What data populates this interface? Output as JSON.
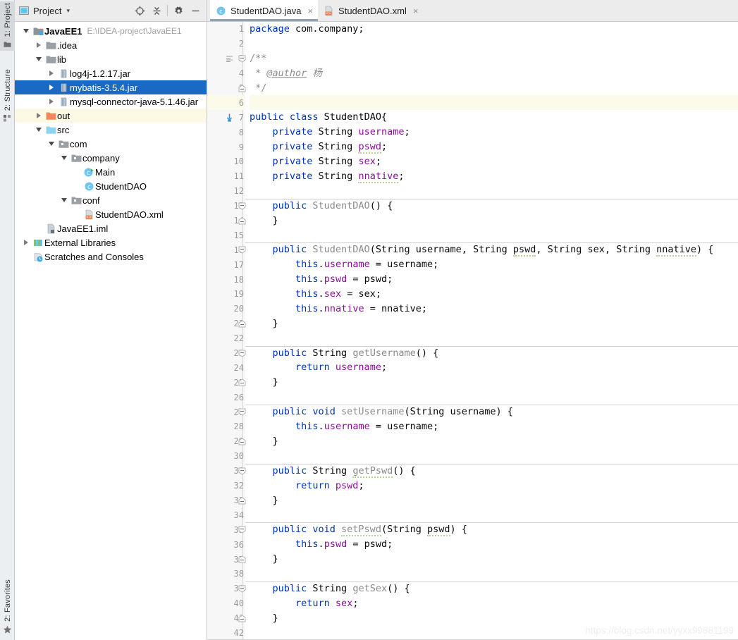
{
  "tool_strip": {
    "tabs": [
      {
        "label": "1: Project",
        "icon": "project-panel-icon",
        "active": true
      },
      {
        "label": "2: Structure",
        "icon": "structure-icon",
        "active": false
      },
      {
        "label": "2: Favorites",
        "icon": "star-icon",
        "active": false
      }
    ]
  },
  "project_panel": {
    "title": "Project",
    "caret": "▾",
    "buttons": [
      {
        "name": "locate-button",
        "icon": "target-icon"
      },
      {
        "name": "collapse-all-button",
        "icon": "collapse-all-icon"
      },
      {
        "name": "settings-button",
        "icon": "gear-icon"
      },
      {
        "name": "hide-button",
        "icon": "minimize-icon"
      }
    ],
    "tree": [
      {
        "label": "JavaEE1",
        "path": "E:\\IDEA-project\\JavaEE1",
        "icon": "module-icon",
        "indent": 0,
        "arrow": "expanded",
        "bold": true,
        "state": "normal"
      },
      {
        "label": ".idea",
        "path": "",
        "icon": "folder-icon",
        "indent": 1,
        "arrow": "collapsed",
        "bold": false,
        "state": "normal"
      },
      {
        "label": "lib",
        "path": "",
        "icon": "folder-icon",
        "indent": 1,
        "arrow": "expanded",
        "bold": false,
        "state": "normal"
      },
      {
        "label": "log4j-1.2.17.jar",
        "path": "",
        "icon": "jar-icon",
        "indent": 2,
        "arrow": "collapsed",
        "bold": false,
        "state": "normal"
      },
      {
        "label": "mybatis-3.5.4.jar",
        "path": "",
        "icon": "jar-icon",
        "indent": 2,
        "arrow": "collapsed",
        "bold": false,
        "state": "selected"
      },
      {
        "label": "mysql-connector-java-5.1.46.jar",
        "path": "",
        "icon": "jar-icon",
        "indent": 2,
        "arrow": "collapsed",
        "bold": false,
        "state": "normal"
      },
      {
        "label": "out",
        "path": "",
        "icon": "folder-excluded-icon",
        "indent": 1,
        "arrow": "collapsed",
        "bold": false,
        "state": "excluded"
      },
      {
        "label": "src",
        "path": "",
        "icon": "source-folder-icon",
        "indent": 1,
        "arrow": "expanded",
        "bold": false,
        "state": "normal"
      },
      {
        "label": "com",
        "path": "",
        "icon": "package-icon",
        "indent": 2,
        "arrow": "expanded",
        "bold": false,
        "state": "normal"
      },
      {
        "label": "company",
        "path": "",
        "icon": "package-icon",
        "indent": 3,
        "arrow": "expanded",
        "bold": false,
        "state": "normal"
      },
      {
        "label": "Main",
        "path": "",
        "icon": "java-class-runnable-icon",
        "indent": 4,
        "arrow": "none",
        "bold": false,
        "state": "normal"
      },
      {
        "label": "StudentDAO",
        "path": "",
        "icon": "java-class-icon",
        "indent": 4,
        "arrow": "none",
        "bold": false,
        "state": "normal"
      },
      {
        "label": "conf",
        "path": "",
        "icon": "package-icon",
        "indent": 3,
        "arrow": "expanded",
        "bold": false,
        "state": "normal"
      },
      {
        "label": "StudentDAO.xml",
        "path": "",
        "icon": "xml-file-icon",
        "indent": 4,
        "arrow": "none",
        "bold": false,
        "state": "normal"
      },
      {
        "label": "JavaEE1.iml",
        "path": "",
        "icon": "iml-file-icon",
        "indent": 1,
        "arrow": "none",
        "bold": false,
        "state": "normal"
      },
      {
        "label": "External Libraries",
        "path": "",
        "icon": "libraries-icon",
        "indent": 0,
        "arrow": "collapsed",
        "bold": false,
        "state": "normal"
      },
      {
        "label": "Scratches and Consoles",
        "path": "",
        "icon": "scratches-icon",
        "indent": 0,
        "arrow": "none",
        "bold": false,
        "state": "normal"
      }
    ]
  },
  "editor": {
    "tabs": [
      {
        "label": "StudentDAO.java",
        "icon": "java-class-icon",
        "close": "×",
        "active": true
      },
      {
        "label": "StudentDAO.xml",
        "icon": "xml-file-icon",
        "close": "×",
        "active": false
      }
    ],
    "watermark": "https://blog.csdn.net/yyxx99881199",
    "lines": [
      {
        "n": "1",
        "fold": "none",
        "gicon": "",
        "caret": false,
        "sep": false,
        "tokens": [
          {
            "t": "package ",
            "c": "kw"
          },
          {
            "t": "com.company;",
            "c": "plain"
          }
        ]
      },
      {
        "n": "2",
        "fold": "none",
        "gicon": "",
        "caret": false,
        "sep": false,
        "tokens": []
      },
      {
        "n": "3",
        "fold": "start",
        "gicon": "javadoc-icon",
        "caret": false,
        "sep": false,
        "tokens": [
          {
            "t": "/**",
            "c": "cmt"
          }
        ]
      },
      {
        "n": "4",
        "fold": "bar",
        "gicon": "",
        "caret": false,
        "sep": false,
        "tokens": [
          {
            "t": " * ",
            "c": "cmt"
          },
          {
            "t": "@author",
            "c": "ann"
          },
          {
            "t": " ",
            "c": "cmt"
          },
          {
            "t": "杨",
            "c": "cmti"
          }
        ]
      },
      {
        "n": "5",
        "fold": "end",
        "gicon": "",
        "caret": false,
        "sep": false,
        "tokens": [
          {
            "t": " */",
            "c": "cmt"
          }
        ]
      },
      {
        "n": "6",
        "fold": "none",
        "gicon": "",
        "caret": true,
        "sep": false,
        "tokens": []
      },
      {
        "n": "7",
        "fold": "none",
        "gicon": "subclass-icon",
        "caret": false,
        "sep": false,
        "tokens": [
          {
            "t": "public class ",
            "c": "kw"
          },
          {
            "t": "StudentDAO{",
            "c": "plain"
          }
        ]
      },
      {
        "n": "8",
        "fold": "none",
        "gicon": "",
        "caret": false,
        "sep": false,
        "tokens": [
          {
            "t": "    private ",
            "c": "kw"
          },
          {
            "t": "String ",
            "c": "plain"
          },
          {
            "t": "username",
            "c": "fld"
          },
          {
            "t": ";",
            "c": "plain"
          }
        ]
      },
      {
        "n": "9",
        "fold": "none",
        "gicon": "",
        "caret": false,
        "sep": false,
        "tokens": [
          {
            "t": "    private ",
            "c": "kw"
          },
          {
            "t": "String ",
            "c": "plain"
          },
          {
            "t": "pswd",
            "c": "fld typo"
          },
          {
            "t": ";",
            "c": "plain"
          }
        ]
      },
      {
        "n": "10",
        "fold": "none",
        "gicon": "",
        "caret": false,
        "sep": false,
        "tokens": [
          {
            "t": "    private ",
            "c": "kw"
          },
          {
            "t": "String ",
            "c": "plain"
          },
          {
            "t": "sex",
            "c": "fld"
          },
          {
            "t": ";",
            "c": "plain"
          }
        ]
      },
      {
        "n": "11",
        "fold": "none",
        "gicon": "",
        "caret": false,
        "sep": false,
        "tokens": [
          {
            "t": "    private ",
            "c": "kw"
          },
          {
            "t": "String ",
            "c": "plain"
          },
          {
            "t": "nnative",
            "c": "fld typo"
          },
          {
            "t": ";",
            "c": "plain"
          }
        ]
      },
      {
        "n": "12",
        "fold": "none",
        "gicon": "",
        "caret": false,
        "sep": false,
        "tokens": []
      },
      {
        "n": "13",
        "fold": "start",
        "gicon": "",
        "caret": false,
        "sep": true,
        "tokens": [
          {
            "t": "    public ",
            "c": "kw"
          },
          {
            "t": "StudentDAO",
            "c": "mname"
          },
          {
            "t": "() {",
            "c": "plain"
          }
        ]
      },
      {
        "n": "14",
        "fold": "end",
        "gicon": "",
        "caret": false,
        "sep": false,
        "tokens": [
          {
            "t": "    }",
            "c": "plain"
          }
        ]
      },
      {
        "n": "15",
        "fold": "none",
        "gicon": "",
        "caret": false,
        "sep": false,
        "tokens": []
      },
      {
        "n": "16",
        "fold": "start",
        "gicon": "",
        "caret": false,
        "sep": true,
        "tokens": [
          {
            "t": "    public ",
            "c": "kw"
          },
          {
            "t": "StudentDAO",
            "c": "mname"
          },
          {
            "t": "(String username, String ",
            "c": "plain"
          },
          {
            "t": "pswd",
            "c": "plain typo"
          },
          {
            "t": ", String sex, String ",
            "c": "plain"
          },
          {
            "t": "nnative",
            "c": "plain typo"
          },
          {
            "t": ") {",
            "c": "plain"
          }
        ]
      },
      {
        "n": "17",
        "fold": "bar",
        "gicon": "",
        "caret": false,
        "sep": false,
        "tokens": [
          {
            "t": "        this",
            "c": "kw"
          },
          {
            "t": ".",
            "c": "plain"
          },
          {
            "t": "username",
            "c": "fld"
          },
          {
            "t": " = username;",
            "c": "plain"
          }
        ]
      },
      {
        "n": "18",
        "fold": "bar",
        "gicon": "",
        "caret": false,
        "sep": false,
        "tokens": [
          {
            "t": "        this",
            "c": "kw"
          },
          {
            "t": ".",
            "c": "plain"
          },
          {
            "t": "pswd",
            "c": "fld"
          },
          {
            "t": " = pswd;",
            "c": "plain"
          }
        ]
      },
      {
        "n": "19",
        "fold": "bar",
        "gicon": "",
        "caret": false,
        "sep": false,
        "tokens": [
          {
            "t": "        this",
            "c": "kw"
          },
          {
            "t": ".",
            "c": "plain"
          },
          {
            "t": "sex",
            "c": "fld"
          },
          {
            "t": " = sex;",
            "c": "plain"
          }
        ]
      },
      {
        "n": "20",
        "fold": "bar",
        "gicon": "",
        "caret": false,
        "sep": false,
        "tokens": [
          {
            "t": "        this",
            "c": "kw"
          },
          {
            "t": ".",
            "c": "plain"
          },
          {
            "t": "nnative",
            "c": "fld"
          },
          {
            "t": " = nnative;",
            "c": "plain"
          }
        ]
      },
      {
        "n": "21",
        "fold": "end",
        "gicon": "",
        "caret": false,
        "sep": false,
        "tokens": [
          {
            "t": "    }",
            "c": "plain"
          }
        ]
      },
      {
        "n": "22",
        "fold": "none",
        "gicon": "",
        "caret": false,
        "sep": false,
        "tokens": []
      },
      {
        "n": "23",
        "fold": "start",
        "gicon": "",
        "caret": false,
        "sep": true,
        "tokens": [
          {
            "t": "    public ",
            "c": "kw"
          },
          {
            "t": "String ",
            "c": "plain"
          },
          {
            "t": "getUsername",
            "c": "mname"
          },
          {
            "t": "() {",
            "c": "plain"
          }
        ]
      },
      {
        "n": "24",
        "fold": "bar",
        "gicon": "",
        "caret": false,
        "sep": false,
        "tokens": [
          {
            "t": "        return ",
            "c": "kw"
          },
          {
            "t": "username",
            "c": "fld"
          },
          {
            "t": ";",
            "c": "plain"
          }
        ]
      },
      {
        "n": "25",
        "fold": "end",
        "gicon": "",
        "caret": false,
        "sep": false,
        "tokens": [
          {
            "t": "    }",
            "c": "plain"
          }
        ]
      },
      {
        "n": "26",
        "fold": "none",
        "gicon": "",
        "caret": false,
        "sep": false,
        "tokens": []
      },
      {
        "n": "27",
        "fold": "start",
        "gicon": "",
        "caret": false,
        "sep": true,
        "tokens": [
          {
            "t": "    public ",
            "c": "kw"
          },
          {
            "t": "void ",
            "c": "kw"
          },
          {
            "t": "setUsername",
            "c": "mname"
          },
          {
            "t": "(String username) {",
            "c": "plain"
          }
        ]
      },
      {
        "n": "28",
        "fold": "bar",
        "gicon": "",
        "caret": false,
        "sep": false,
        "tokens": [
          {
            "t": "        this",
            "c": "kw"
          },
          {
            "t": ".",
            "c": "plain"
          },
          {
            "t": "username",
            "c": "fld"
          },
          {
            "t": " = username;",
            "c": "plain"
          }
        ]
      },
      {
        "n": "29",
        "fold": "end",
        "gicon": "",
        "caret": false,
        "sep": false,
        "tokens": [
          {
            "t": "    }",
            "c": "plain"
          }
        ]
      },
      {
        "n": "30",
        "fold": "none",
        "gicon": "",
        "caret": false,
        "sep": false,
        "tokens": []
      },
      {
        "n": "31",
        "fold": "start",
        "gicon": "",
        "caret": false,
        "sep": true,
        "tokens": [
          {
            "t": "    public ",
            "c": "kw"
          },
          {
            "t": "String ",
            "c": "plain"
          },
          {
            "t": "getPswd",
            "c": "mname typo"
          },
          {
            "t": "() {",
            "c": "plain"
          }
        ]
      },
      {
        "n": "32",
        "fold": "bar",
        "gicon": "",
        "caret": false,
        "sep": false,
        "tokens": [
          {
            "t": "        return ",
            "c": "kw"
          },
          {
            "t": "pswd",
            "c": "fld"
          },
          {
            "t": ";",
            "c": "plain"
          }
        ]
      },
      {
        "n": "33",
        "fold": "end",
        "gicon": "",
        "caret": false,
        "sep": false,
        "tokens": [
          {
            "t": "    }",
            "c": "plain"
          }
        ]
      },
      {
        "n": "34",
        "fold": "none",
        "gicon": "",
        "caret": false,
        "sep": false,
        "tokens": []
      },
      {
        "n": "35",
        "fold": "start",
        "gicon": "",
        "caret": false,
        "sep": true,
        "tokens": [
          {
            "t": "    public ",
            "c": "kw"
          },
          {
            "t": "void ",
            "c": "kw"
          },
          {
            "t": "setPswd",
            "c": "mname typo"
          },
          {
            "t": "(String ",
            "c": "plain"
          },
          {
            "t": "pswd",
            "c": "plain typo"
          },
          {
            "t": ") {",
            "c": "plain"
          }
        ]
      },
      {
        "n": "36",
        "fold": "bar",
        "gicon": "",
        "caret": false,
        "sep": false,
        "tokens": [
          {
            "t": "        this",
            "c": "kw"
          },
          {
            "t": ".",
            "c": "plain"
          },
          {
            "t": "pswd",
            "c": "fld"
          },
          {
            "t": " = pswd;",
            "c": "plain"
          }
        ]
      },
      {
        "n": "37",
        "fold": "end",
        "gicon": "",
        "caret": false,
        "sep": false,
        "tokens": [
          {
            "t": "    }",
            "c": "plain"
          }
        ]
      },
      {
        "n": "38",
        "fold": "none",
        "gicon": "",
        "caret": false,
        "sep": false,
        "tokens": []
      },
      {
        "n": "39",
        "fold": "start",
        "gicon": "",
        "caret": false,
        "sep": true,
        "tokens": [
          {
            "t": "    public ",
            "c": "kw"
          },
          {
            "t": "String ",
            "c": "plain"
          },
          {
            "t": "getSex",
            "c": "mname"
          },
          {
            "t": "() {",
            "c": "plain"
          }
        ]
      },
      {
        "n": "40",
        "fold": "bar",
        "gicon": "",
        "caret": false,
        "sep": false,
        "tokens": [
          {
            "t": "        return ",
            "c": "kw"
          },
          {
            "t": "sex",
            "c": "fld"
          },
          {
            "t": ";",
            "c": "plain"
          }
        ]
      },
      {
        "n": "41",
        "fold": "end",
        "gicon": "",
        "caret": false,
        "sep": false,
        "tokens": [
          {
            "t": "    }",
            "c": "plain"
          }
        ]
      },
      {
        "n": "42",
        "fold": "none",
        "gicon": "",
        "caret": false,
        "sep": false,
        "tokens": []
      }
    ]
  },
  "colors": {
    "selection_blue": "#1a69c5",
    "excluded_yellow": "#fdf9e4",
    "caret_row": "#fcfbe9",
    "keyword_blue": "#0033b3",
    "field_purple": "#871094",
    "method_grey": "#8a8a8a",
    "comment_grey": "#8c8c8c"
  }
}
